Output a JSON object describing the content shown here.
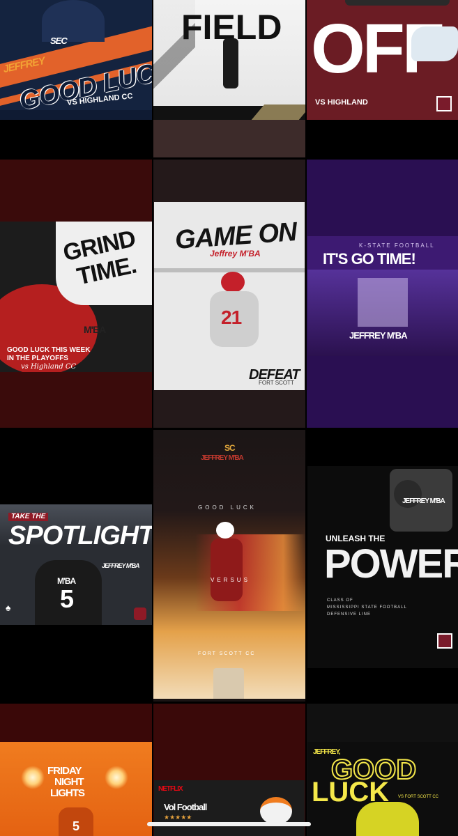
{
  "posts": {
    "r1c1": {
      "name": "JEFFREY",
      "headline": "GOOD LUCK",
      "sub": "VS HIGHLAND CC",
      "badge": "SEC"
    },
    "r1c2": {
      "headline": "FIELD"
    },
    "r1c3": {
      "headline": "OFF",
      "sub": "VS HIGHLAND"
    },
    "r2c1": {
      "headline_1": "GRIND",
      "headline_2": "TIME.",
      "sub_1": "GOOD LUCK THIS WEEK",
      "sub_2": "IN THE PLAYOFFS",
      "sub_3": "vs Highland CC",
      "jersey": "M'BA"
    },
    "r2c2": {
      "headline": "GAME ON",
      "name": "Jeffrey M'BA",
      "footer": "DEFEAT",
      "footer_sub": "FORT SCOTT",
      "number": "21"
    },
    "r2c3": {
      "eyebrow": "K-STATE FOOTBALL",
      "headline": "IT'S GO TIME!",
      "name": "JEFFREY M'BA"
    },
    "r3c1": {
      "eyebrow": "TAKE THE",
      "headline": "SPOTLIGHT",
      "name": "JEFFREY M'BA",
      "jersey_name": "M'BA",
      "number": "5"
    },
    "r3c2": {
      "logo": "SC",
      "name": "JEFFREY M'BA",
      "line_1": "GOOD LUCK",
      "line_2": "VERSUS",
      "line_3": "FORT SCOTT CC"
    },
    "r3c3": {
      "name": "JEFFREY M'BA",
      "eyebrow": "UNLEASH THE",
      "headline": "POWER",
      "sub_1": "CLASS OF",
      "sub_2": "MISSISSIPPI STATE FOOTBALL",
      "sub_3": "DEFENSIVE LINE"
    },
    "r4c1": {
      "headline_1": "FRIDAY",
      "headline_2": "NIGHT",
      "headline_3": "LIGHTS",
      "number": "5"
    },
    "r4c2": {
      "brand": "NETFLIX",
      "title": "Vol Football",
      "stars": "★★★★★"
    },
    "r4c3": {
      "name": "JEFFREY,",
      "headline_1": "GOOD",
      "headline_2": "LUCK",
      "sub": "VS FORT SCOTT CC"
    }
  },
  "colors": {
    "r1c1_bg": "#14233f",
    "r1c1_accent": "#e2622a",
    "r1c3_bg": "#6b1c24",
    "r2c1_tile": "#3a0b0b",
    "r2c2_tile": "#24191a",
    "r2c3_tile": "#2a0f52",
    "r3c1_tile": "#000000",
    "r3c2_tile": "#1a1414",
    "r3c3_tile": "#000000",
    "r4c1_tile": "#3a0808",
    "r4c2_tile": "#3a0909",
    "r4c3_tile": "#111111"
  }
}
